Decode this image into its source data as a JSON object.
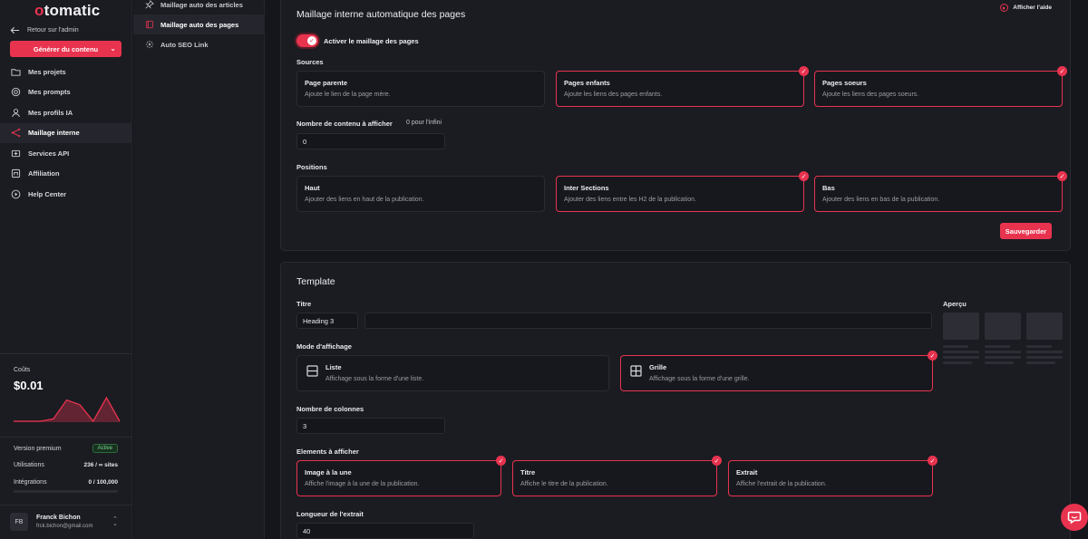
{
  "brand": {
    "logo_first": "o",
    "logo_rest": "tomatic",
    "accent": "#e8334f"
  },
  "sidebar": {
    "back_label": "Retour sur l'admin",
    "generate_label": "Générer du contenu",
    "items": [
      {
        "label": "Mes projets",
        "icon": "folder-icon"
      },
      {
        "label": "Mes prompts",
        "icon": "target-icon"
      },
      {
        "label": "Mes profils IA",
        "icon": "user-icon"
      },
      {
        "label": "Maillage interne",
        "icon": "share-icon"
      },
      {
        "label": "Services API",
        "icon": "api-icon"
      },
      {
        "label": "Affiliation",
        "icon": "affiliate-icon"
      },
      {
        "label": "Help Center",
        "icon": "play-circle-icon"
      }
    ],
    "costs_label": "Coûts",
    "costs_value": "$0.01",
    "cost_history": [
      0,
      0,
      0,
      0.05,
      0.45,
      0.35,
      0,
      0.5,
      0
    ],
    "plan_label": "Version premium",
    "plan_badge": "Active",
    "usage_label": "Utilisations",
    "usage_value": "236 / ∞ sites",
    "integrations_label": "Intégrations",
    "integrations_value": "0 / 100,000",
    "integrations_fraction": 0,
    "user_initials": "FB",
    "user_name": "Franck Bichon",
    "user_email": "frck.bichon@gmail.com"
  },
  "subnav": {
    "items": [
      {
        "label": "Maillage auto des articles",
        "icon": "pin-icon"
      },
      {
        "label": "Maillage auto des pages",
        "icon": "page-icon"
      },
      {
        "label": "Auto SEO Link",
        "icon": "link-icon"
      }
    ]
  },
  "linking": {
    "title": "Maillage interne automatique des pages",
    "help_label": "Afficher l'aide",
    "toggle_label": "Activer le maillage des pages",
    "sources_label": "Sources",
    "sources": [
      {
        "title": "Page parente",
        "desc": "Ajoute le lien de la page mère.",
        "selected": false
      },
      {
        "title": "Pages enfants",
        "desc": "Ajoute les liens des pages enfants.",
        "selected": true
      },
      {
        "title": "Pages soeurs",
        "desc": "Ajoute les liens des pages soeurs.",
        "selected": true
      }
    ],
    "count_label": "Nombre de contenu à afficher",
    "count_hint": "0 pour l'infini",
    "count_value": "0",
    "positions_label": "Positions",
    "positions": [
      {
        "title": "Haut",
        "desc": "Ajouter des liens en haut de la publication.",
        "selected": false
      },
      {
        "title": "Inter Sections",
        "desc": "Ajouter des liens entre les H2 de la publication.",
        "selected": true
      },
      {
        "title": "Bas",
        "desc": "Ajouter des liens en bas de la publication.",
        "selected": true
      }
    ],
    "save_label": "Sauvegarder"
  },
  "template": {
    "title": "Template",
    "titre_label": "Titre",
    "heading_value": "Heading 3",
    "title_input_value": "",
    "preview_label": "Aperçu",
    "mode_label": "Mode d'affichage",
    "modes": [
      {
        "title": "Liste",
        "desc": "Affichage sous la forme d'une liste.",
        "selected": false,
        "icon": "list-layout-icon"
      },
      {
        "title": "Grille",
        "desc": "Affichage sous la forme d'une grille.",
        "selected": true,
        "icon": "grid-layout-icon"
      }
    ],
    "columns_label": "Nombre de colonnes",
    "columns_value": "3",
    "elements_label": "Elements à afficher",
    "elements": [
      {
        "title": "Image à la une",
        "desc": "Affiche l'image à la une de la publication.",
        "selected": true
      },
      {
        "title": "Titre",
        "desc": "Affiche le titre de la publication.",
        "selected": true
      },
      {
        "title": "Extrait",
        "desc": "Affiche l'extrait de la publication.",
        "selected": true
      }
    ],
    "excerpt_label": "Longueur de l'extrait",
    "excerpt_value": "40"
  }
}
